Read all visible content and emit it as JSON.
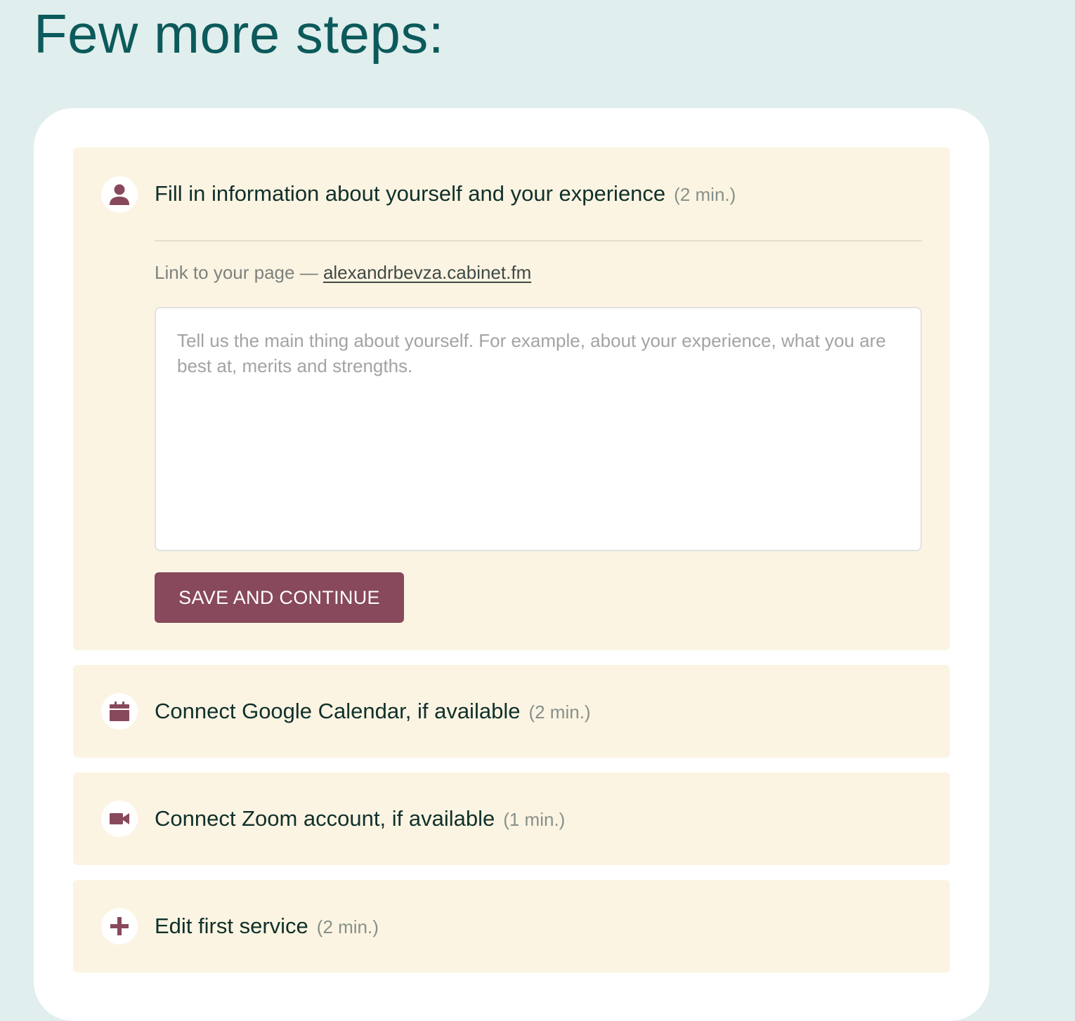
{
  "page": {
    "title": "Few more steps:"
  },
  "colors": {
    "background": "#e0eeed",
    "title": "#0c5a5b",
    "step_background": "#fcf4e2",
    "accent": "#87495b",
    "muted": "#86908a"
  },
  "steps": [
    {
      "icon": "person-icon",
      "title": "Fill in information about yourself and your experience",
      "time": "(2 min.)",
      "expanded": true,
      "link_label": "Link to your page —",
      "link_text": "alexandrbevza.cabinet.fm",
      "about_placeholder": "Tell us the main thing about yourself. For example, about your experience, what you are best at, merits and strengths.",
      "about_value": "",
      "save_label": "SAVE AND CONTINUE"
    },
    {
      "icon": "calendar-icon",
      "title": "Connect Google Calendar, if available",
      "time": "(2 min.)"
    },
    {
      "icon": "video-camera-icon",
      "title": "Connect Zoom account, if available",
      "time": "(1 min.)"
    },
    {
      "icon": "plus-icon",
      "title": "Edit first service",
      "time": "(2 min.)"
    }
  ]
}
